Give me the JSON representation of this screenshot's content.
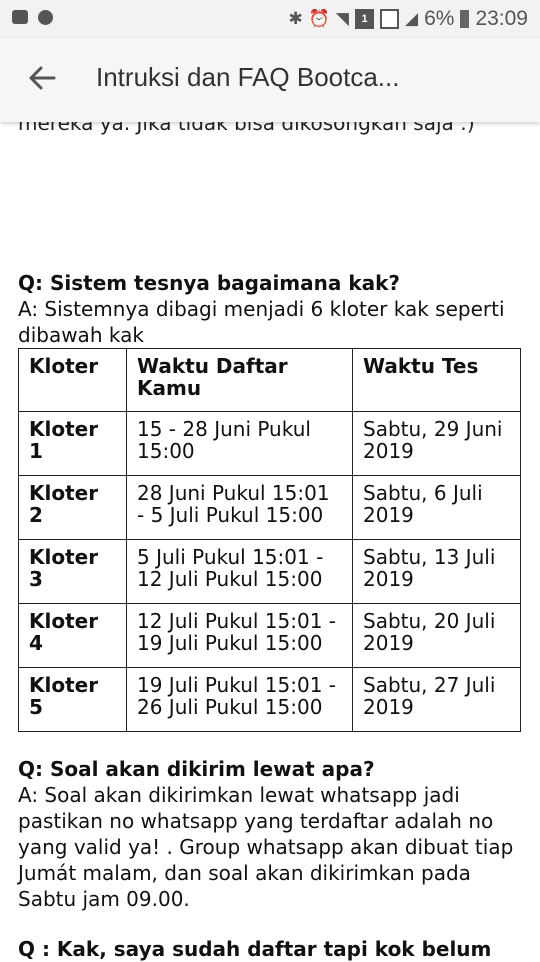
{
  "status_bar": {
    "battery": "6%",
    "time": "23:09",
    "sim": "1"
  },
  "app_bar": {
    "title": "Intruksi dan FAQ Bootca..."
  },
  "content": {
    "partial_line": "mereka ya. Jika tidak bisa dikosongkan saja :)",
    "q1": "Q: Sistem tesnya bagaimana kak?",
    "a1": "A: Sistemnya dibagi menjadi 6 kloter kak seperti dibawah kak",
    "table": {
      "headers": [
        "Kloter",
        "Waktu Daftar Kamu",
        "Waktu Tes"
      ],
      "rows": [
        [
          "Kloter 1",
          "15 - 28  Juni Pukul 15:00",
          "Sabtu, 29 Juni 2019"
        ],
        [
          "Kloter 2",
          "28 Juni Pukul 15:01 - 5 Juli Pukul 15:00",
          "Sabtu, 6 Juli 2019"
        ],
        [
          "Kloter 3",
          "5 Juli Pukul 15:01 - 12 Juli Pukul 15:00",
          "Sabtu, 13 Juli 2019"
        ],
        [
          "Kloter 4",
          "12 Juli Pukul 15:01 - 19 Juli Pukul 15:00",
          "Sabtu, 20 Juli 2019"
        ],
        [
          "Kloter 5",
          "19 Juli Pukul 15:01 - 26 Juli Pukul 15:00",
          "Sabtu, 27 Juli 2019"
        ]
      ]
    },
    "q2": "Q: Soal akan dikirim lewat apa?",
    "a2": "A: Soal akan dikirimkan lewat whatsapp jadi pastikan no whatsapp yang terdaftar adalah no yang valid ya! . Group whatsapp akan dibuat tiap Jumát malam, dan soal akan dikirimkan pada Sabtu jam 09.00.",
    "q3": "Q : Kak, saya sudah daftar tapi kok belum"
  }
}
